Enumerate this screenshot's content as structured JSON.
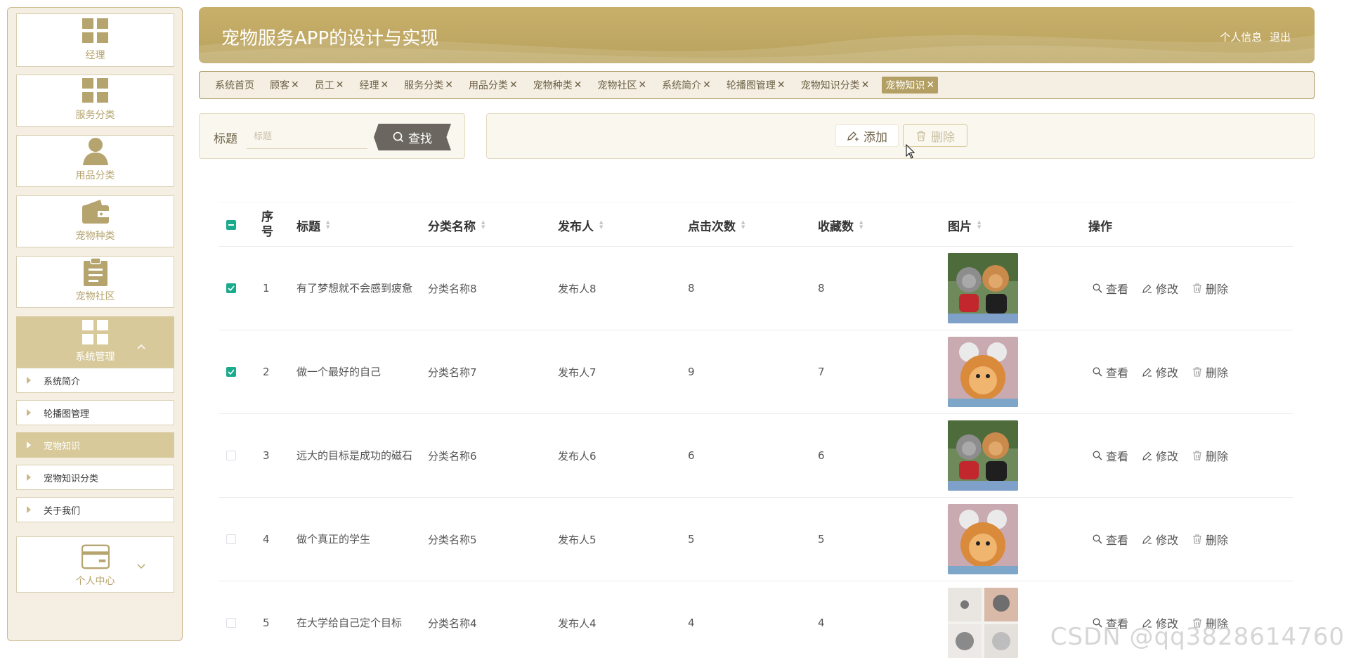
{
  "header": {
    "title": "宠物服务APP的设计与实现",
    "profile_link": "个人信息",
    "logout_link": "退出"
  },
  "sidebar": {
    "menus": [
      {
        "label": "经理",
        "icon": "grid-icon"
      },
      {
        "label": "服务分类",
        "icon": "grid-icon"
      },
      {
        "label": "用品分类",
        "icon": "user-icon"
      },
      {
        "label": "宠物种类",
        "icon": "wallet-icon"
      },
      {
        "label": "宠物社区",
        "icon": "clipboard-icon"
      },
      {
        "label": "系统管理",
        "icon": "grid-icon",
        "expanded": true
      }
    ],
    "submenu": [
      {
        "label": "系统简介"
      },
      {
        "label": "轮播图管理"
      },
      {
        "label": "宠物知识",
        "active": true
      },
      {
        "label": "宠物知识分类"
      },
      {
        "label": "关于我们"
      }
    ],
    "profile_menu": {
      "label": "个人中心",
      "icon": "card-icon"
    }
  },
  "tabs": [
    {
      "label": "系统首页",
      "closable": false
    },
    {
      "label": "顾客",
      "closable": true
    },
    {
      "label": "员工",
      "closable": true
    },
    {
      "label": "经理",
      "closable": true
    },
    {
      "label": "服务分类",
      "closable": true
    },
    {
      "label": "用品分类",
      "closable": true
    },
    {
      "label": "宠物种类",
      "closable": true
    },
    {
      "label": "宠物社区",
      "closable": true
    },
    {
      "label": "系统简介",
      "closable": true
    },
    {
      "label": "轮播图管理",
      "closable": true
    },
    {
      "label": "宠物知识分类",
      "closable": true
    },
    {
      "label": "宠物知识",
      "closable": true,
      "active": true
    }
  ],
  "search": {
    "label": "标题",
    "placeholder": "标题",
    "button": "查找"
  },
  "actions": {
    "add": "添加",
    "delete": "删除"
  },
  "table": {
    "columns": [
      "序号",
      "标题",
      "分类名称",
      "发布人",
      "点击次数",
      "收藏数",
      "图片",
      "操作"
    ],
    "ops": {
      "view": "查看",
      "edit": "修改",
      "delete": "删除"
    },
    "rows": [
      {
        "checked": true,
        "index": "1",
        "title": "有了梦想就不会感到疲惫",
        "category": "分类名称8",
        "publisher": "发布人8",
        "clicks": "8",
        "favorites": "8",
        "image": "two-dogs-photo"
      },
      {
        "checked": true,
        "index": "2",
        "title": "做一个最好的自己",
        "category": "分类名称7",
        "publisher": "发布人7",
        "clicks": "9",
        "favorites": "7",
        "image": "pomeranian-photo"
      },
      {
        "checked": false,
        "index": "3",
        "title": "远大的目标是成功的磁石",
        "category": "分类名称6",
        "publisher": "发布人6",
        "clicks": "6",
        "favorites": "6",
        "image": "two-dogs-photo"
      },
      {
        "checked": false,
        "index": "4",
        "title": "做个真正的学生",
        "category": "分类名称5",
        "publisher": "发布人5",
        "clicks": "5",
        "favorites": "5",
        "image": "pomeranian-photo"
      },
      {
        "checked": false,
        "index": "5",
        "title": "在大学给自己定个目标",
        "category": "分类名称4",
        "publisher": "发布人4",
        "clicks": "4",
        "favorites": "4",
        "image": "dog-collage-photo"
      }
    ]
  },
  "watermark": "CSDN @qq3828614760"
}
